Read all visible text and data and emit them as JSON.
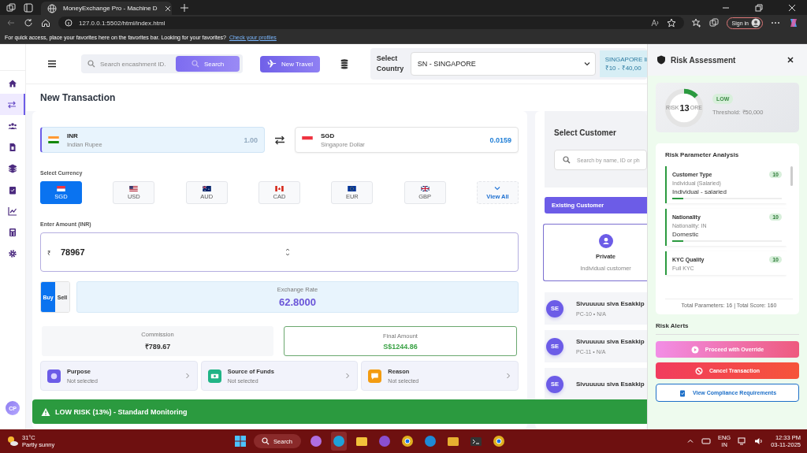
{
  "browser": {
    "tab_title": "MoneyExchange Pro - Machine D",
    "url": "127.0.0.1:5502/html/index.html",
    "sign_in": "Sign in",
    "favorites_text": "For quick access, place your favorites here on the favorites bar. Looking for your favorites?",
    "favorites_link": "Check your profiles"
  },
  "sidebar": {
    "items": [
      {
        "kind": "home",
        "selected": false
      },
      {
        "kind": "exchange",
        "selected": true
      },
      {
        "kind": "users",
        "selected": false
      },
      {
        "kind": "document",
        "selected": false
      },
      {
        "kind": "layers",
        "selected": false
      },
      {
        "kind": "clipboard",
        "selected": false
      },
      {
        "kind": "chart",
        "selected": false
      },
      {
        "kind": "calculator",
        "selected": false
      },
      {
        "kind": "settings",
        "selected": false
      }
    ],
    "avatar": "CP"
  },
  "header": {
    "search_placeholder": "Search encashment ID.",
    "search_button": "Search",
    "new_travel": "New Travel",
    "country_label": "Select Country",
    "country_value": "SN - SINGAPORE",
    "country_info": [
      "SINGAPORE li",
      "₹10 - ₹40,00"
    ]
  },
  "page_title": "New Transaction",
  "from_currency": {
    "kind": "in",
    "code": "INR",
    "name": "Indian Rupee",
    "value": "1.00"
  },
  "to_currency": {
    "kind": "sg",
    "code": "SGD",
    "name": "Singapore Dollar",
    "value": "0.0159"
  },
  "currency_label": "Select Currency",
  "currencies": [
    {
      "kind": "sg",
      "code": "SGD",
      "selected": true
    },
    {
      "kind": "us",
      "code": "USD",
      "selected": false
    },
    {
      "kind": "au",
      "code": "AUD",
      "selected": false
    },
    {
      "kind": "ca",
      "code": "CAD",
      "selected": false
    },
    {
      "kind": "eu",
      "code": "EUR",
      "selected": false
    },
    {
      "kind": "gb",
      "code": "GBP",
      "selected": false
    }
  ],
  "view_all": "View All",
  "amount": {
    "label": "Enter Amount (INR)",
    "symbol": "₹",
    "value": "78967"
  },
  "trade": [
    {
      "label": "Buy",
      "selected": true
    },
    {
      "label": "Sell",
      "selected": false
    }
  ],
  "exchange_rate": {
    "label": "Exchange Rate",
    "value": "62.8000"
  },
  "commission": {
    "label": "Commission",
    "value": "₹789.67"
  },
  "final_amount": {
    "label": "Final Amount",
    "value": "S$1244.86"
  },
  "selectors": [
    {
      "kind": "purpose",
      "title": "Purpose",
      "value": "Not selected",
      "color": "#6c5ce7"
    },
    {
      "kind": "funds",
      "title": "Source of Funds",
      "value": "Not selected",
      "color": "#20b486"
    },
    {
      "kind": "reason",
      "title": "Reason",
      "value": "Not selected",
      "color": "#f39c12"
    }
  ],
  "customer": {
    "title": "Select Customer",
    "search_placeholder": "Search by name, ID or ph",
    "tab": "Existing Customer",
    "type": {
      "title": "Private",
      "subtitle": "Individual customer"
    },
    "list": [
      {
        "initials": "SE",
        "name": "Sivuuuuu siva Esakkip",
        "meta": "PC-10 • N/A"
      },
      {
        "initials": "SE",
        "name": "Sivuuuuu siva Esakkip",
        "meta": "PC-11 • N/A"
      },
      {
        "initials": "SE",
        "name": "Sivuuuuu siva Esakkip"
      }
    ]
  },
  "status_banner": {
    "kind": "low",
    "text": "LOW RISK (13%) - Standard Monitoring"
  },
  "risk_panel": {
    "title": "Risk Assessment",
    "score": "13",
    "score_label": [
      "RISK",
      "ORE"
    ],
    "level": 0.13,
    "badge": "LOW",
    "threshold": "Threshold: ₹50,000",
    "analysis_title": "Risk Parameter Analysis",
    "parameters": [
      {
        "name": "Customer Type",
        "score": "10",
        "detail": "Individual (Salaried)",
        "value": "Individual - salaried",
        "level": 0.1
      },
      {
        "name": "Nationality",
        "score": "10",
        "detail": "Nationality: IN",
        "value": "Domestic",
        "level": 0.1
      },
      {
        "name": "KYC Quality",
        "score": "10",
        "detail": "Full KYC"
      }
    ],
    "summary": "Total Parameters: 16 | Total Score: 160",
    "alerts_title": "Risk Alerts",
    "actions": [
      {
        "kind": "override",
        "label": "Proceed with Override"
      },
      {
        "kind": "cancel",
        "label": "Cancel Transaction"
      },
      {
        "kind": "compliance",
        "label": "View Compliance Requirements"
      }
    ]
  },
  "taskbar": {
    "temperature": "31°C",
    "weather": "Partly sunny",
    "search": "Search",
    "apps": [
      {
        "kind": "copilot",
        "selected": false
      },
      {
        "kind": "edge",
        "selected": true
      },
      {
        "kind": "folder",
        "selected": false
      },
      {
        "kind": "vs",
        "selected": false
      },
      {
        "kind": "chrome",
        "selected": false
      },
      {
        "kind": "vscode",
        "selected": false
      },
      {
        "kind": "tool",
        "selected": false
      },
      {
        "kind": "terminal",
        "selected": false
      },
      {
        "kind": "chrome",
        "selected": false
      }
    ],
    "language": [
      "ENG",
      "IN"
    ],
    "time": "12:33 PM",
    "date": "03-11-2025"
  }
}
